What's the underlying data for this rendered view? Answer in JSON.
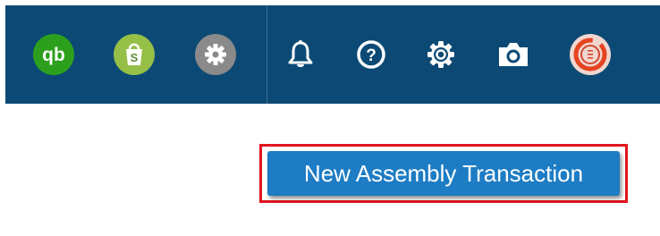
{
  "topbar": {
    "apps": [
      {
        "name": "quickbooks-icon",
        "glyph": "qb",
        "color": "#2ca01c"
      },
      {
        "name": "shopify-icon",
        "glyph": "S",
        "color": "#95bf47"
      },
      {
        "name": "app-settings-icon",
        "color": "#8a8a8a"
      }
    ],
    "utilities": [
      "bell-icon",
      "help-icon",
      "gear-icon",
      "camera-icon",
      "avatar"
    ]
  },
  "main": {
    "new_assembly_label": "New Assembly Transaction"
  },
  "colors": {
    "topbar_bg": "#0c4a75",
    "primary_button": "#1d7cc4",
    "highlight_border": "#e0151e"
  }
}
